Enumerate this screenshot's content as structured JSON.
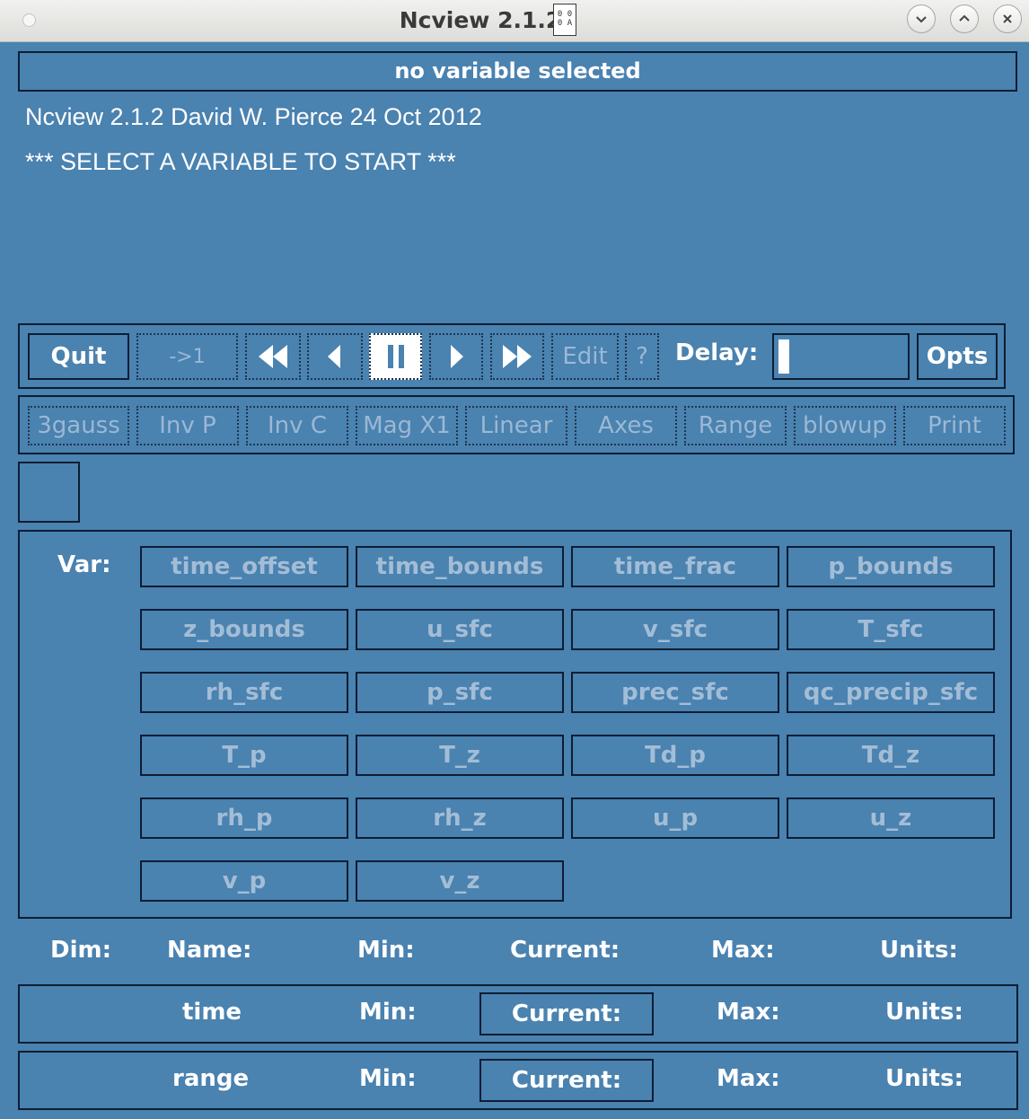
{
  "window": {
    "title": "Ncview 2.1.2",
    "icon_text": [
      "0 0",
      "0 A"
    ]
  },
  "variable_header": "no variable selected",
  "info_lines": [
    "Ncview 2.1.2 David W. Pierce  24 Oct 2012",
    "*** SELECT A VARIABLE TO START ***"
  ],
  "toolbar": {
    "quit_label": "Quit",
    "back_to_one_label": "->1",
    "edit_label": "Edit",
    "help_label": "?",
    "delay_label": "Delay:",
    "opts_label": "Opts"
  },
  "options_bar": [
    "3gauss",
    "Inv P",
    "Inv C",
    "Mag X1",
    "Linear",
    "Axes",
    "Range",
    "blowup",
    "Print"
  ],
  "var_label": "Var:",
  "variables": [
    "time_offset",
    "time_bounds",
    "time_frac",
    "p_bounds",
    "z_bounds",
    "u_sfc",
    "v_sfc",
    "T_sfc",
    "rh_sfc",
    "p_sfc",
    "prec_sfc",
    "qc_precip_sfc",
    "T_p",
    "T_z",
    "Td_p",
    "Td_z",
    "rh_p",
    "rh_z",
    "u_p",
    "u_z",
    "v_p",
    "v_z"
  ],
  "dim_header": {
    "dim": "Dim:",
    "name": "Name:",
    "min": "Min:",
    "current": "Current:",
    "max": "Max:",
    "units": "Units:"
  },
  "dim_rows": [
    {
      "name": "time",
      "min": "Min:",
      "current": "Current:",
      "max": "Max:",
      "units": "Units:"
    },
    {
      "name": "range",
      "min": "Min:",
      "current": "Current:",
      "max": "Max:",
      "units": "Units:"
    }
  ],
  "colors": {
    "background": "#4a82b0",
    "border": "#0d1e33",
    "disabled_text": "#a3bdd6",
    "text": "#ffffff"
  }
}
